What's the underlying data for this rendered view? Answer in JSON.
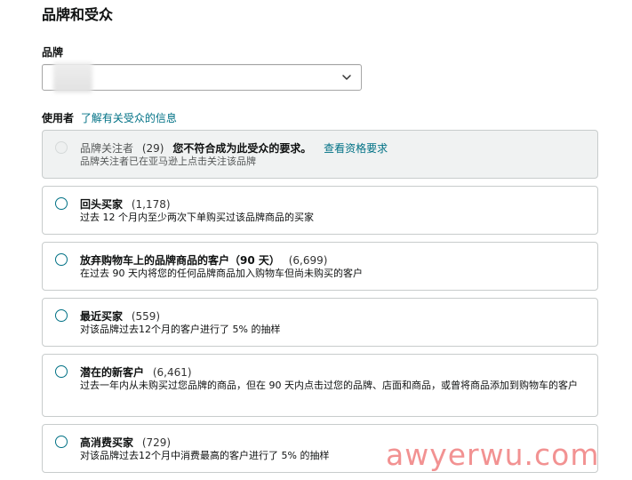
{
  "page": {
    "title": "品牌和受众"
  },
  "brand": {
    "label": "品牌",
    "selected_value": ""
  },
  "audience": {
    "label": "使用者",
    "learn_more_link": "了解有关受众的信息",
    "options": [
      {
        "name": "品牌关注者",
        "count": "(29)",
        "warning": "您不符合成为此受众的要求。",
        "requirements_link": "查看资格要求",
        "description": "品牌关注者已在亚马逊上点击关注该品牌",
        "disabled": true
      },
      {
        "name": "回头买家",
        "count": "(1,178)",
        "description": "过去 12 个月内至少两次下单购买过该品牌商品的买家"
      },
      {
        "name": "放弃购物车上的品牌商品的客户（90 天）",
        "count": "(6,699)",
        "description": "在过去 90 天内将您的任何品牌商品加入购物车但尚未购买的客户"
      },
      {
        "name": "最近买家",
        "count": "(559)",
        "description": "对该品牌过去12个月的客户进行了 5% 的抽样"
      },
      {
        "name": "潜在的新客户",
        "count": "(6,461)",
        "description": "过去一年内从未购买过您品牌的商品，但在 90 天内点击过您的品牌、店面和商品，或曾将商品添加到购物车的客户"
      },
      {
        "name": "高消费买家",
        "count": "(729)",
        "description": "对该品牌过去12个月中消费最高的客户进行了 5% 的抽样"
      }
    ]
  },
  "watermark": "awyerwu.com",
  "colors": {
    "link": "#007185",
    "card_border": "#c8cccc",
    "disabled_bg": "#f0f2f2",
    "watermark": "#ee6e6e"
  }
}
